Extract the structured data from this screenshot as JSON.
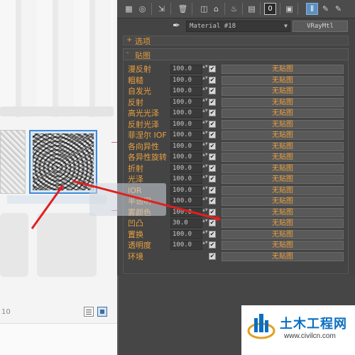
{
  "browser": {
    "scroll_number": "10"
  },
  "editor": {
    "material_name": "Material #18",
    "material_type": "VRayMtl",
    "toolbar": {
      "icons": [
        "pick-material-icon",
        "material-effects-icon",
        "put-to-scene-icon",
        "assign-icon",
        "delete-icon",
        "get-material-icon",
        "make-unique-icon",
        "material-id-icon",
        "save-icon",
        "channel-zero-icon",
        "show-map-icon",
        "show-end-result-icon",
        "go-to-parent-icon",
        "go-forward-icon"
      ],
      "channel_label": "0"
    },
    "rollouts": {
      "options_sign": "+",
      "options_title": "选项",
      "maps_sign": "-",
      "maps_title": "贴图"
    },
    "maps": [
      {
        "label": "漫反射",
        "amount": "100.0",
        "checked": true,
        "slot": "无贴图"
      },
      {
        "label": "粗糙",
        "amount": "100.0",
        "checked": true,
        "slot": "无贴图"
      },
      {
        "label": "自发光",
        "amount": "100.0",
        "checked": true,
        "slot": "无贴图"
      },
      {
        "label": "反射",
        "amount": "100.0",
        "checked": true,
        "slot": "无贴图"
      },
      {
        "label": "高光光泽",
        "amount": "100.0",
        "checked": true,
        "slot": "无贴图"
      },
      {
        "label": "反射光泽",
        "amount": "100.0",
        "checked": true,
        "slot": "无贴图"
      },
      {
        "label": "菲涅尔 IOF",
        "amount": "100.0",
        "checked": true,
        "slot": "无贴图"
      },
      {
        "label": "各向异性",
        "amount": "100.0",
        "checked": true,
        "slot": "无贴图"
      },
      {
        "label": "各异性旋转",
        "amount": "100.0",
        "checked": true,
        "slot": "无贴图"
      },
      {
        "label": "折射",
        "amount": "100.0",
        "checked": true,
        "slot": "无贴图"
      },
      {
        "label": "光泽",
        "amount": "100.0",
        "checked": true,
        "slot": "无贴图"
      },
      {
        "label": "IOR",
        "amount": "100.0",
        "checked": true,
        "slot": "无贴图"
      },
      {
        "label": "半透明",
        "amount": "100.0",
        "checked": true,
        "slot": "无贴图"
      },
      {
        "label": "雾颜色",
        "amount": "100.0",
        "checked": true,
        "slot": "无贴图"
      },
      {
        "label": "凹凸",
        "amount": "30.0",
        "checked": true,
        "slot": "无贴图"
      },
      {
        "label": "置换",
        "amount": "100.0",
        "checked": true,
        "slot": "无贴图"
      },
      {
        "label": "透明度",
        "amount": "100.0",
        "checked": true,
        "slot": "无贴图"
      },
      {
        "label": "环境",
        "amount": "",
        "checked": true,
        "slot": "无贴图"
      }
    ]
  },
  "logo": {
    "title": "土木工程网",
    "url": "www.civilcn.com"
  },
  "colors": {
    "accent_orange": "#e8a040",
    "arrow_red": "#e02020",
    "selection_blue": "#3d8bd8",
    "panel_bg": "#444444"
  }
}
